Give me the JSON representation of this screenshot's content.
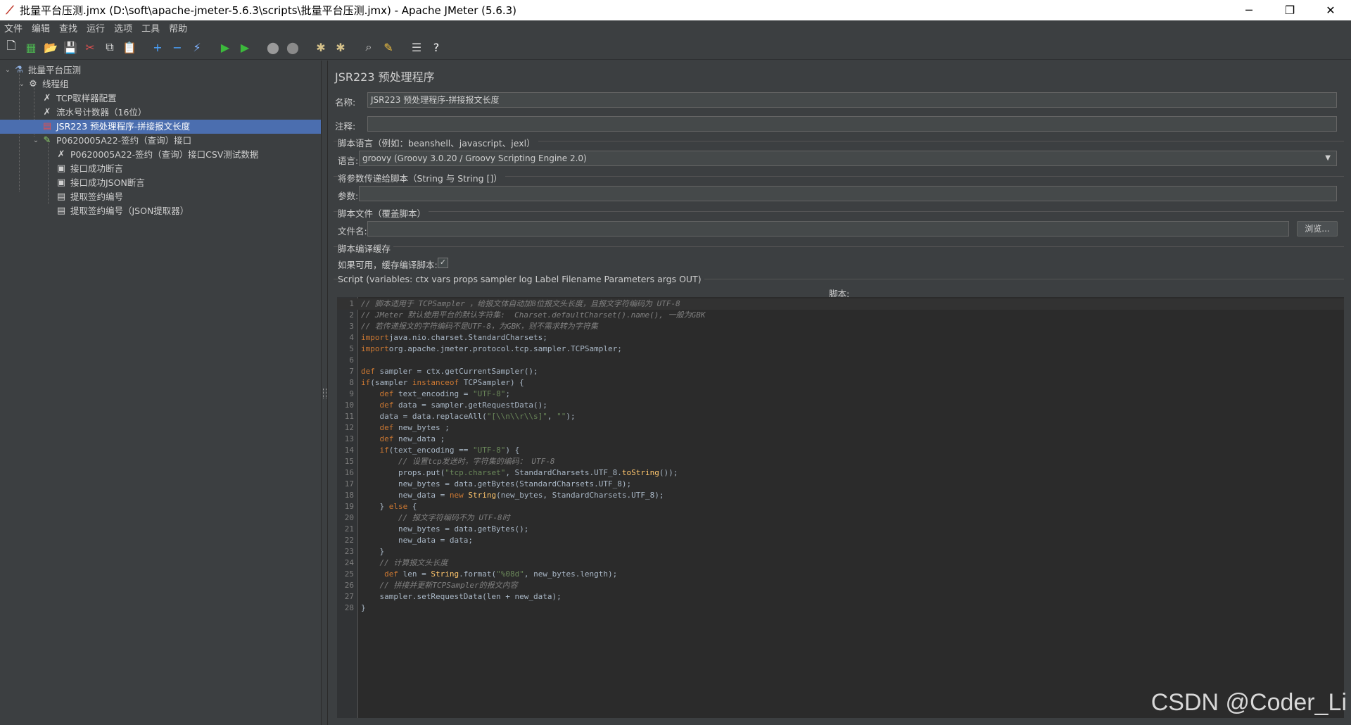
{
  "window": {
    "title": "批量平台压测.jmx (D:\\soft\\apache-jmeter-5.6.3\\scripts\\批量平台压测.jmx) - Apache JMeter (5.6.3)",
    "minimize": "─",
    "restore": "❐",
    "close": "✕"
  },
  "menu": [
    "文件",
    "编辑",
    "查找",
    "运行",
    "选项",
    "工具",
    "帮助"
  ],
  "toolbar": {
    "buttons": [
      {
        "name": "new-icon",
        "glyph": "🗋",
        "color": "#ffffff"
      },
      {
        "name": "templates-icon",
        "glyph": "▦",
        "color": "#4caf50"
      },
      {
        "name": "open-icon",
        "glyph": "📂",
        "color": "#e0a83a"
      },
      {
        "name": "save-icon",
        "glyph": "💾",
        "color": "#cccccc"
      },
      {
        "name": "cut-icon",
        "glyph": "✂",
        "color": "#e05050"
      },
      {
        "name": "copy-icon",
        "glyph": "⧉",
        "color": "#dddddd"
      },
      {
        "name": "paste-icon",
        "glyph": "📋",
        "color": "#dddddd"
      },
      {
        "name": "expand-all-icon",
        "glyph": "+",
        "color": "#4aa3ff"
      },
      {
        "name": "collapse-all-icon",
        "glyph": "−",
        "color": "#4aa3ff"
      },
      {
        "name": "toggle-icon",
        "glyph": "⚡",
        "color": "#7fb2ff"
      },
      {
        "name": "start-icon",
        "glyph": "▶",
        "color": "#3cb93c"
      },
      {
        "name": "start-no-pauses-icon",
        "glyph": "▶",
        "color": "#3cb93c"
      },
      {
        "name": "stop-icon",
        "glyph": "⬤",
        "color": "#9a9a9a"
      },
      {
        "name": "shutdown-icon",
        "glyph": "⬤",
        "color": "#8a8a8a"
      },
      {
        "name": "clear-icon",
        "glyph": "✱",
        "color": "#d6c28a"
      },
      {
        "name": "clear-all-icon",
        "glyph": "✱",
        "color": "#d6c28a"
      },
      {
        "name": "search-icon",
        "glyph": "⌕",
        "color": "#cccccc"
      },
      {
        "name": "reset-search-icon",
        "glyph": "✎",
        "color": "#f0c040"
      },
      {
        "name": "function-helper-icon",
        "glyph": "☰",
        "color": "#cccccc"
      },
      {
        "name": "help-icon",
        "glyph": "?",
        "color": "#ffffff"
      }
    ]
  },
  "tree": [
    {
      "label": "批量平台压测",
      "icon": "⚗",
      "icon_name": "test-plan-icon",
      "icon_color": "#8fb0e0",
      "indent": 0,
      "toggle": "⌄"
    },
    {
      "label": "线程组",
      "icon": "⚙",
      "icon_name": "thread-group-icon",
      "icon_color": "#d0d0d0",
      "indent": 1,
      "toggle": "⌄"
    },
    {
      "label": "TCP取样器配置",
      "icon": "✗",
      "icon_name": "config-element-icon",
      "icon_color": "#d0d0d0",
      "indent": 2,
      "toggle": ""
    },
    {
      "label": "流水号计数器（16位）",
      "icon": "✗",
      "icon_name": "counter-icon",
      "icon_color": "#d0d0d0",
      "indent": 2,
      "toggle": ""
    },
    {
      "label": "JSR223 预处理程序-拼接报文长度",
      "icon": "▤",
      "icon_name": "preprocessor-icon",
      "icon_color": "#e05050",
      "indent": 2,
      "toggle": "",
      "selected": true
    },
    {
      "label": "P0620005A22-签约（查询）接口",
      "icon": "✎",
      "icon_name": "sampler-icon",
      "icon_color": "#8ccf6a",
      "indent": 2,
      "toggle": "⌄"
    },
    {
      "label": "P0620005A22-签约（查询）接口CSV测试数据",
      "icon": "✗",
      "icon_name": "csv-config-icon",
      "icon_color": "#d0d0d0",
      "indent": 3,
      "toggle": ""
    },
    {
      "label": "接口成功断言",
      "icon": "▣",
      "icon_name": "assertion-icon",
      "icon_color": "#d0d0d0",
      "indent": 3,
      "toggle": ""
    },
    {
      "label": "接口成功JSON断言",
      "icon": "▣",
      "icon_name": "json-assertion-icon",
      "icon_color": "#d0d0d0",
      "indent": 3,
      "toggle": ""
    },
    {
      "label": "提取签约编号",
      "icon": "▤",
      "icon_name": "extractor-icon",
      "icon_color": "#d0d0d0",
      "indent": 3,
      "toggle": ""
    },
    {
      "label": "提取签约编号（JSON提取器）",
      "icon": "▤",
      "icon_name": "json-extractor-icon",
      "icon_color": "#d0d0d0",
      "indent": 3,
      "toggle": ""
    }
  ],
  "form": {
    "heading": "JSR223 预处理程序",
    "name_label": "名称:",
    "name_value": "JSR223 预处理程序-拼接报文长度",
    "comment_label": "注释:",
    "comment_value": "",
    "lang_group": "脚本语言（例如：beanshell、javascript、jexl）",
    "lang_label": "语言:",
    "lang_value": "groovy     (Groovy 3.0.20 / Groovy Scripting Engine 2.0)",
    "params_group": "将参数传递给脚本（String 与 String []）",
    "params_label": "参数:",
    "file_group": "脚本文件（覆盖脚本）",
    "file_label": "文件名:",
    "browse_label": "浏览...",
    "cache_group": "脚本编译缓存",
    "cache_label": "如果可用，缓存编译脚本:",
    "cache_checked": "✓",
    "script_group": "Script (variables: ctx vars props sampler log Label Filename Parameters args OUT)",
    "script_label": "脚本:"
  },
  "code": [
    [
      [
        "cm",
        "// 脚本适用于 TCPSampler ，给报文体自动加8位报文头长度，且报文字符编码为 UTF-8"
      ]
    ],
    [
      [
        "cm",
        "// JMeter 默认使用平台的默认字符集:  Charset.defaultCharset().name(), 一般为GBK"
      ]
    ],
    [
      [
        "cm",
        "// 若传递报文的字符编码不是UTF-8，为GBK，则不需求转为字符集"
      ]
    ],
    [
      [
        "kw",
        "import"
      ],
      [
        "",
        "java.nio.charset.StandardCharsets;"
      ]
    ],
    [
      [
        "kw",
        "import"
      ],
      [
        "",
        "org.apache.jmeter.protocol.tcp.sampler.TCPSampler;"
      ]
    ],
    [],
    [
      [
        "kw",
        "def"
      ],
      [
        "",
        " sampler = ctx.getCurrentSampler();"
      ]
    ],
    [
      [
        "kw",
        "if"
      ],
      [
        "",
        "(sampler "
      ],
      [
        "kw",
        "instanceof"
      ],
      [
        "",
        " TCPSampler) {"
      ]
    ],
    [
      [
        "",
        "    "
      ],
      [
        "kw",
        "def"
      ],
      [
        "",
        " text_encoding = "
      ],
      [
        "str",
        "\"UTF-8\""
      ],
      [
        "",
        ";"
      ]
    ],
    [
      [
        "",
        "    "
      ],
      [
        "kw",
        "def"
      ],
      [
        "",
        " data = sampler.getRequestData();"
      ]
    ],
    [
      [
        "",
        "    data = data.replaceAll("
      ],
      [
        "str",
        "\"[\\\\n\\\\r\\\\s]\""
      ],
      [
        "",
        ", "
      ],
      [
        "str",
        "\"\""
      ],
      [
        "",
        ");"
      ]
    ],
    [
      [
        "",
        "    "
      ],
      [
        "kw",
        "def"
      ],
      [
        "",
        " new_bytes ;"
      ]
    ],
    [
      [
        "",
        "    "
      ],
      [
        "kw",
        "def"
      ],
      [
        "",
        " new_data ;"
      ]
    ],
    [
      [
        "",
        "    "
      ],
      [
        "kw",
        "if"
      ],
      [
        "",
        "(text_encoding == "
      ],
      [
        "str",
        "\"UTF-8\""
      ],
      [
        "",
        ") {"
      ]
    ],
    [
      [
        "",
        "        "
      ],
      [
        "cm",
        "// 设置tcp发送时，字符集的编码： UTF-8"
      ]
    ],
    [
      [
        "",
        "        props.put("
      ],
      [
        "str",
        "\"tcp.charset\""
      ],
      [
        "",
        ", StandardCharsets.UTF_8."
      ],
      [
        "fn",
        "toString"
      ],
      [
        "",
        "());"
      ]
    ],
    [
      [
        "",
        "        new_bytes = data.getBytes(StandardCharsets.UTF_8);"
      ]
    ],
    [
      [
        "",
        "        new_data = "
      ],
      [
        "kw",
        "new"
      ],
      [
        "",
        " "
      ],
      [
        "fn",
        "String"
      ],
      [
        "",
        "(new_bytes, StandardCharsets.UTF_8);"
      ]
    ],
    [
      [
        "",
        "    } "
      ],
      [
        "kw",
        "else"
      ],
      [
        "",
        " {"
      ]
    ],
    [
      [
        "",
        "        "
      ],
      [
        "cm",
        "// 报文字符编码不为 UTF-8时"
      ]
    ],
    [
      [
        "",
        "        new_bytes = data.getBytes();"
      ]
    ],
    [
      [
        "",
        "        new_data = data;"
      ]
    ],
    [
      [
        "",
        "    }"
      ]
    ],
    [
      [
        "",
        "    "
      ],
      [
        "cm",
        "// 计算报文头长度"
      ]
    ],
    [
      [
        "",
        "     "
      ],
      [
        "kw",
        "def"
      ],
      [
        "",
        " len = "
      ],
      [
        "fn",
        "String"
      ],
      [
        "",
        ".format("
      ],
      [
        "str",
        "\"%08d\""
      ],
      [
        "",
        ", new_bytes.length);"
      ]
    ],
    [
      [
        "",
        "    "
      ],
      [
        "cm",
        "// 拼接并更新TCPSampler的报文内容"
      ]
    ],
    [
      [
        "",
        "    sampler.setRequestData(len + new_data);"
      ]
    ],
    [
      [
        "",
        "}"
      ]
    ]
  ],
  "watermark": "CSDN @Coder_Li"
}
